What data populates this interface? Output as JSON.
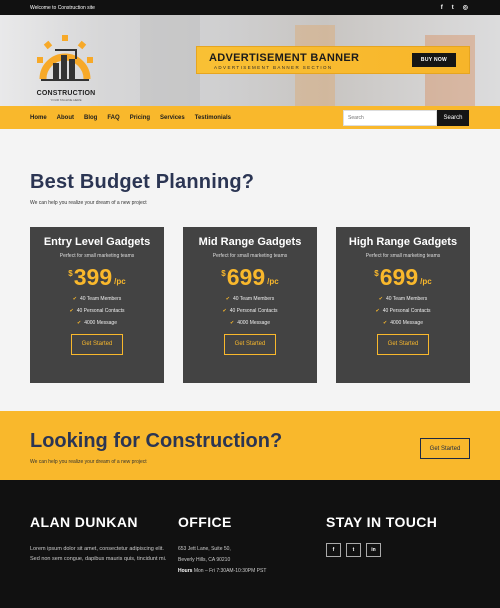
{
  "topbar": {
    "welcome": "Welcome to Construction site",
    "socials": [
      {
        "icon": "facebook-icon",
        "glyph": "f"
      },
      {
        "icon": "twitter-icon",
        "glyph": "t"
      },
      {
        "icon": "instagram-icon",
        "glyph": "◎"
      }
    ]
  },
  "header": {
    "logo_text": "CONSTRUCTION",
    "logo_tagline": "YOUR TAGLINE HERE",
    "ad_title": "ADVERTISEMENT BANNER",
    "ad_subtitle": "ADVERTISEMENT BANNER SECTION",
    "ad_button": "BUY NOW"
  },
  "nav": {
    "items": [
      "Home",
      "About",
      "Blog",
      "FAQ",
      "Pricing",
      "Services",
      "Testimonials"
    ],
    "search_placeholder": "Search",
    "search_button": "Search"
  },
  "pricing": {
    "title": "Best Budget Planning?",
    "subtitle": "We can help you realize your dream of a new project",
    "plans": [
      {
        "name": "Entry Level Gadgets",
        "desc": "Perfect for small marketing teams",
        "currency": "$",
        "price": "399",
        "period": "/pc",
        "features": [
          "40 Team Members",
          "40 Personal Contacts",
          "4000 Message"
        ],
        "cta": "Get Started"
      },
      {
        "name": "Mid Range Gadgets",
        "desc": "Perfect for small marketing teams",
        "currency": "$",
        "price": "699",
        "period": "/pc",
        "features": [
          "40 Team Members",
          "40 Personal Contacts",
          "4000 Message"
        ],
        "cta": "Get Started"
      },
      {
        "name": "High Range Gadgets",
        "desc": "Perfect for small marketing teams",
        "currency": "$",
        "price": "699",
        "period": "/pc",
        "features": [
          "40 Team Members",
          "40 Personal Contacts",
          "4000 Message"
        ],
        "cta": "Get Started"
      }
    ]
  },
  "band": {
    "title": "Looking for Construction?",
    "subtitle": "We can help you realize your dream of a new project",
    "button": "Get Started"
  },
  "footer": {
    "col1_title": "ALAN DUNKAN",
    "col1_text": "Lorem ipsum dolor sit amet, consectetur adipiscing elit. Sed non sem congue, dapibus mauris quis, tincidunt mi.",
    "col2_title": "OFFICE",
    "address1": "653 Jett Lane, Suite 50,",
    "address2": "Beverly Hills, CA 90210",
    "hours_label": "Hours",
    "hours_value": "Mon – Fri 7:30AM-10:30PM PST",
    "col3_title": "STAY IN TOUCH",
    "socials": [
      {
        "icon": "facebook-icon",
        "glyph": "f"
      },
      {
        "icon": "twitter-icon",
        "glyph": "t"
      },
      {
        "icon": "linkedin-icon",
        "glyph": "in"
      }
    ]
  },
  "colors": {
    "accent": "#f9b82c",
    "dark": "#111111",
    "card": "#434343",
    "heading": "#2b3553"
  }
}
